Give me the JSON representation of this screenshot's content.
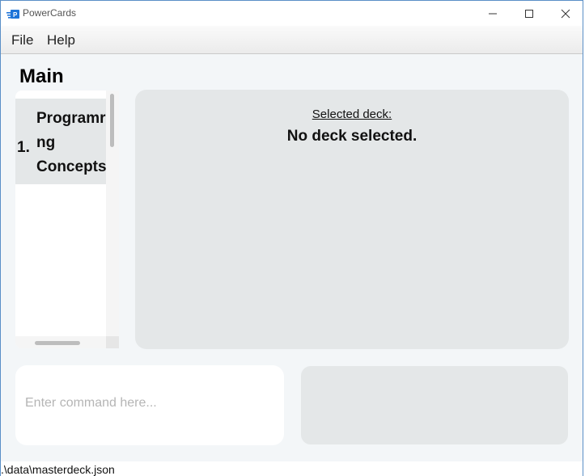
{
  "window": {
    "title": "PowerCards",
    "controls": {
      "minimize": "—",
      "maximize": "☐",
      "close": "✕"
    }
  },
  "menu": {
    "file": "File",
    "help": "Help"
  },
  "main": {
    "heading": "Main"
  },
  "deck_list": {
    "items": [
      {
        "index": "1.",
        "name": "Programr\nng\nConcepts"
      }
    ]
  },
  "detail": {
    "label": "Selected deck:",
    "value": "No deck selected."
  },
  "command": {
    "placeholder": "Enter command here..."
  },
  "status": {
    "path": ".\\data\\masterdeck.json"
  },
  "colors": {
    "accent": "#1e74d8",
    "panel": "#e4e7e8",
    "background": "#f3f6f8"
  }
}
